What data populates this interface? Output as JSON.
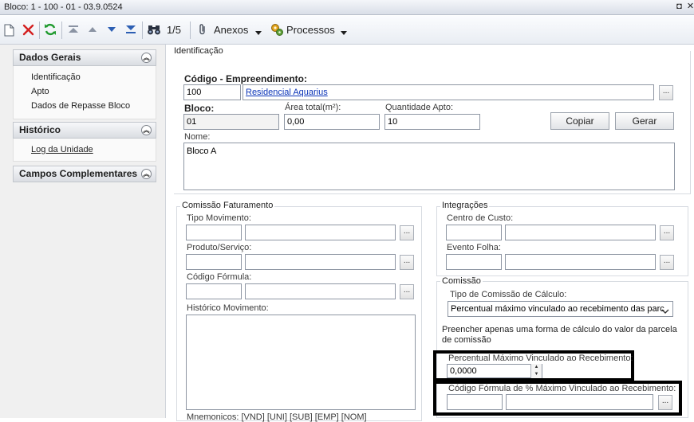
{
  "window": {
    "title": "Bloco: 1 - 100 - 01 - 03.9.0524",
    "restore_glyph": "◘",
    "close_glyph": "✕"
  },
  "toolbar": {
    "record_position": "1/5",
    "anexos_label": "Anexos",
    "processos_label": "Processos",
    "icons": [
      "new-icon",
      "delete-icon",
      "refresh-icon",
      "first-icon",
      "previous-icon",
      "next-icon",
      "last-icon",
      "binoculars-icon",
      "paperclip-icon",
      "process-icon"
    ]
  },
  "nav": {
    "sections": [
      {
        "title": "Dados Gerais",
        "items": [
          "Identificação",
          "Apto",
          "Dados de Repasse Bloco"
        ]
      },
      {
        "title": "Histórico",
        "items": [
          "Log da Unidade"
        ]
      },
      {
        "title": "Campos Complementares",
        "items": []
      }
    ]
  },
  "identificacao": {
    "section_title": "Identificação",
    "codigo_label": "Código - Empreendimento:",
    "codigo_value": "100",
    "empreendimento_value": "Residencial Aquarius",
    "bloco_label": "Bloco:",
    "bloco_value": "01",
    "area_label": "Área total(m²):",
    "area_value": "0,00",
    "quantidade_label": "Quantidade Apto:",
    "quantidade_value": "10",
    "copiar_label": "Copiar",
    "gerar_label": "Gerar",
    "nome_label": "Nome:",
    "nome_value": "Bloco A",
    "ellipsis": "..."
  },
  "comissao_faturamento": {
    "title": "Comissão Faturamento",
    "tipo_movimento_label": "Tipo Movimento:",
    "produto_label": "Produto/Serviço:",
    "codigo_formula_label": "Código Fórmula:",
    "historico_label": "Histórico Movimento:",
    "mnemonicos_label": "Mnemonicos: [VND] [UNI] [SUB] [EMP] [NOM]"
  },
  "integracoes": {
    "title": "Integrações",
    "centro_custo_label": "Centro de Custo:",
    "evento_folha_label": "Evento Folha:"
  },
  "comissao": {
    "title": "Comissão",
    "tipo_label": "Tipo de Comissão de Cálculo:",
    "tipo_value": "Percentual máximo vinculado ao recebimento das parc",
    "hint": "Preencher apenas uma forma de cálculo do valor da parcela de comissão",
    "percentual_label": "Percentual Máximo Vinculado ao Recebimento:",
    "percentual_value": "0,0000",
    "codigo_formula_label": "Código Fórmula de % Máximo Vinculado ao Recebimento:"
  },
  "colors": {
    "link": "#0b34b8",
    "delete_red": "#d42020",
    "refresh_green": "#1f9a2e",
    "nav_blue": "#2d5fb3"
  }
}
